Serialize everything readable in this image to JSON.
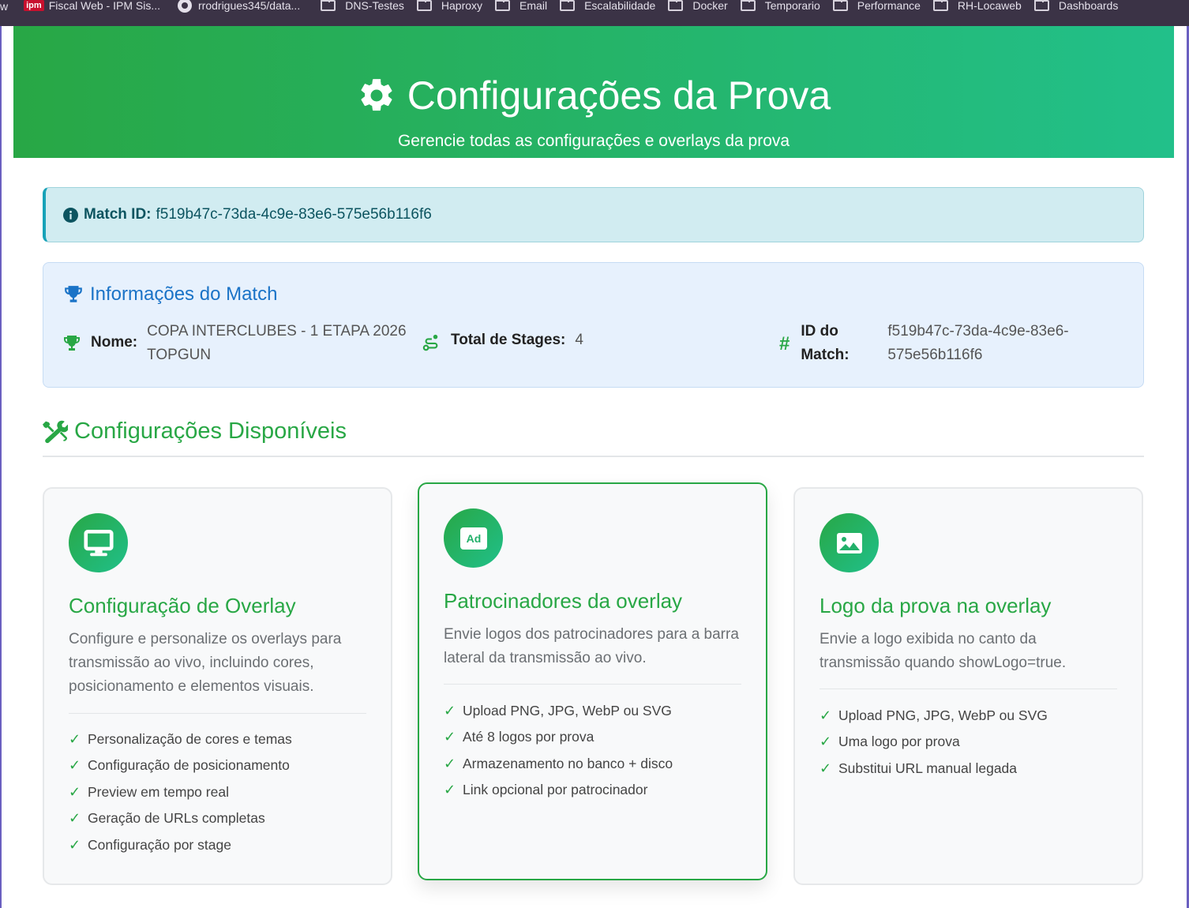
{
  "bookmarks": {
    "edge_label": "w",
    "items": [
      {
        "icon": "ipm-icon",
        "badge": "ipm",
        "label": "Fiscal Web - IPM Sis..."
      },
      {
        "icon": "github-icon",
        "label": "rrodrigues345/data..."
      },
      {
        "icon": "folder-icon",
        "label": "DNS-Testes"
      },
      {
        "icon": "folder-icon",
        "label": "Haproxy"
      },
      {
        "icon": "folder-icon",
        "label": "Email"
      },
      {
        "icon": "folder-icon",
        "label": "Escalabilidade"
      },
      {
        "icon": "folder-icon",
        "label": "Docker"
      },
      {
        "icon": "folder-icon",
        "label": "Temporario"
      },
      {
        "icon": "folder-icon",
        "label": "Performance"
      },
      {
        "icon": "folder-icon",
        "label": "RH-Locaweb"
      },
      {
        "icon": "folder-icon",
        "label": "Dashboards"
      }
    ]
  },
  "header": {
    "title": "Configurações da Prova",
    "subtitle": "Gerencie todas as configurações e overlays da prova",
    "icon": "gear-icon"
  },
  "alert": {
    "label": "Match ID:",
    "value": "f519b47c-73da-4c9e-83e6-575e56b116f6",
    "icon": "info-circle-icon"
  },
  "match_info": {
    "title": "Informações do Match",
    "name_label": "Nome:",
    "name_line1": "COPA INTERCLUBES - 1 ETAPA 2026",
    "name_line2": "TOPGUN",
    "stages_label": "Total de Stages:",
    "stages_value": "4",
    "id_label_line1": "ID do",
    "id_label_line2": "Match:",
    "id_value_line1": "f519b47c-73da-4c9e-83e6-",
    "id_value_line2": "575e56b116f6"
  },
  "section": {
    "title": "Configurações Disponíveis",
    "icon": "tools-icon"
  },
  "cards": [
    {
      "icon": "monitor-icon",
      "title": "Configuração de Overlay",
      "description": "Configure e personalize os overlays para transmissão ao vivo, incluindo cores, posicionamento e elementos visuais.",
      "features": [
        "Personalização de cores e temas",
        "Configuração de posicionamento",
        "Preview em tempo real",
        "Geração de URLs completas",
        "Configuração por stage"
      ]
    },
    {
      "icon": "ad-icon",
      "badge_text": "Ad",
      "title": "Patrocinadores da overlay",
      "description": "Envie logos dos patrocinadores para a barra lateral da transmissão ao vivo.",
      "features": [
        "Upload PNG, JPG, WebP ou SVG",
        "Até 8 logos por prova",
        "Armazenamento no banco + disco",
        "Link opcional por patrocinador"
      ]
    },
    {
      "icon": "image-icon",
      "title": "Logo da prova na overlay",
      "description": "Envie a logo exibida no canto da transmissão quando showLogo=true.",
      "features": [
        "Upload PNG, JPG, WebP ou SVG",
        "Uma logo por prova",
        "Substitui URL manual legada"
      ]
    }
  ],
  "check_mark": "✓",
  "colors": {
    "primary_green": "#28a745",
    "gradient_end": "#20c997",
    "info_blue": "#1a73c7",
    "alert_bg": "#d1ecf1",
    "alert_text": "#0c5460"
  }
}
